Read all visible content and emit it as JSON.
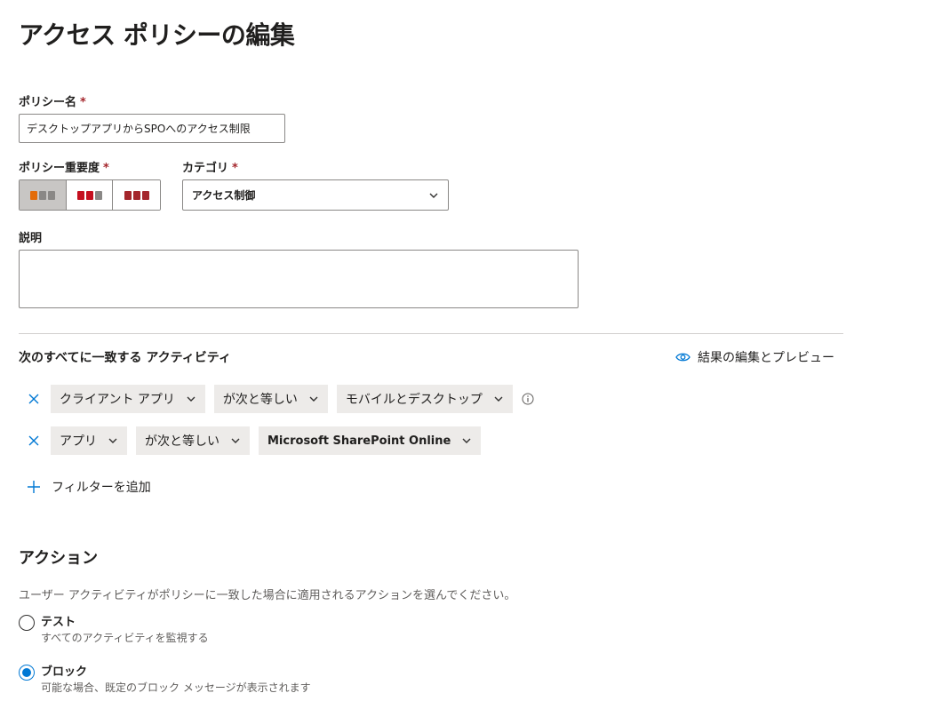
{
  "page": {
    "title": "アクセス ポリシーの編集"
  },
  "policy_name": {
    "label": "ポリシー名",
    "required_mark": "*",
    "value": "デスクトップアプリからSPOへのアクセス制限"
  },
  "severity": {
    "label": "ポリシー重要度",
    "required_mark": "*",
    "selected_index": 0,
    "options": [
      {
        "name": "low",
        "colors": [
          "#e36c0a",
          "#8a8886",
          "#8a8886"
        ]
      },
      {
        "name": "medium",
        "colors": [
          "#c50f1f",
          "#c50f1f",
          "#8a8886"
        ]
      },
      {
        "name": "high",
        "colors": [
          "#a4262c",
          "#a4262c",
          "#a4262c"
        ]
      }
    ]
  },
  "category": {
    "label": "カテゴリ",
    "required_mark": "*",
    "value": "アクセス制御"
  },
  "description": {
    "label": "説明",
    "value": ""
  },
  "activities": {
    "label": "次のすべてに一致する アクティビティ",
    "preview_link": "結果の編集とプレビュー",
    "filters": [
      {
        "field": "クライアント アプリ",
        "operator": "が次と等しい",
        "value": "モバイルとデスクトップ",
        "has_info": true
      },
      {
        "field": "アプリ",
        "operator": "が次と等しい",
        "value": "Microsoft SharePoint Online",
        "has_info": false
      }
    ],
    "add_filter_label": "フィルターを追加"
  },
  "actions": {
    "heading": "アクション",
    "description": "ユーザー アクティビティがポリシーに一致した場合に適用されるアクションを選んでください。",
    "options": [
      {
        "title": "テスト",
        "subtitle": "すべてのアクティビティを監視する",
        "checked": false
      },
      {
        "title": "ブロック",
        "subtitle": "可能な場合、既定のブロック メッセージが表示されます",
        "checked": true
      }
    ]
  },
  "colors": {
    "accent": "#0078d4",
    "required": "#a4262c"
  }
}
